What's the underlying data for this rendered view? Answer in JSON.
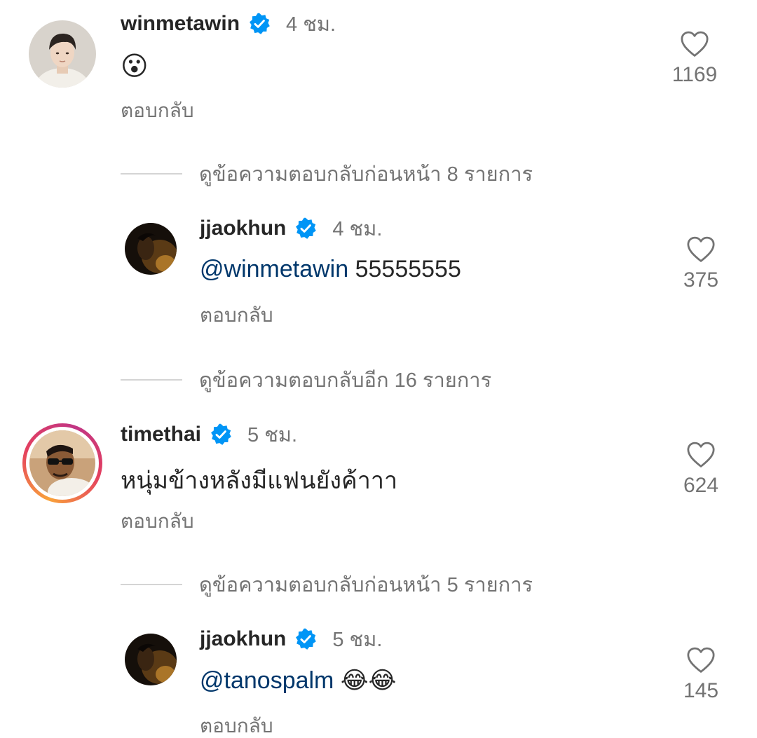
{
  "comments": [
    {
      "username": "winmetawin",
      "time": "4 ชม.",
      "text": "😮",
      "reply_label": "ตอบกลับ",
      "likes": "1169",
      "view_replies": "ดูข้อความตอบกลับก่อนหน้า 8 รายการ",
      "reply": {
        "username": "jjaokhun",
        "time": "4 ชม.",
        "mention": "@winmetawin",
        "text": " 55555555",
        "reply_label": "ตอบกลับ",
        "likes": "375"
      },
      "view_more_replies": "ดูข้อความตอบกลับอีก 16 รายการ"
    },
    {
      "username": "timethai",
      "time": "5 ชม.",
      "text": "หนุ่มข้างหลังมีแฟนยังค้าาา",
      "reply_label": "ตอบกลับ",
      "likes": "624",
      "view_replies": "ดูข้อความตอบกลับก่อนหน้า 5 รายการ",
      "reply": {
        "username": "jjaokhun",
        "time": "5 ชม.",
        "mention": "@tanospalm",
        "text": " 😂😂",
        "reply_label": "ตอบกลับ",
        "likes": "145"
      }
    }
  ],
  "icons": {
    "verified": "verified-badge-icon",
    "like": "heart-outline-icon"
  },
  "colors": {
    "verified_blue": "#0095f6",
    "mention_blue": "#00376b",
    "secondary_text": "#737373"
  }
}
